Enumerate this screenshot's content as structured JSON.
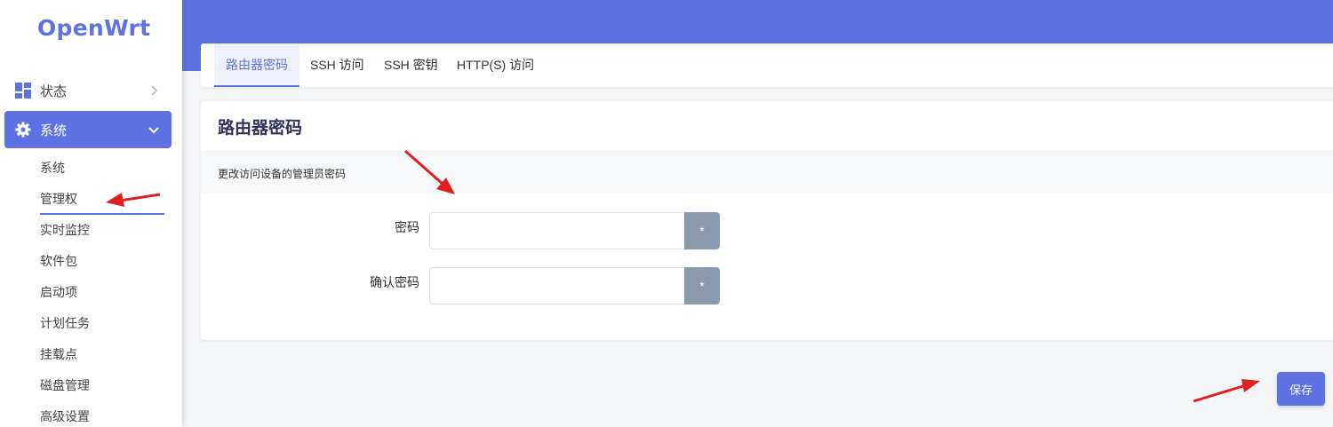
{
  "brand": {
    "logo": "OpenWrt"
  },
  "sidebar": {
    "status": {
      "label": "状态",
      "icon": "dashboard-icon"
    },
    "system": {
      "label": "系统",
      "icon": "gear-icon"
    },
    "sub_items": [
      "系统",
      "管理权",
      "实时监控",
      "软件包",
      "启动项",
      "计划任务",
      "挂载点",
      "磁盘管理",
      "高级设置"
    ]
  },
  "tabs": [
    {
      "label": "路由器密码",
      "active": true
    },
    {
      "label": "SSH 访问"
    },
    {
      "label": "SSH 密钥"
    },
    {
      "label": "HTTP(S) 访问"
    }
  ],
  "section": {
    "title": "路由器密码",
    "description": "更改访问设备的管理员密码",
    "fields": [
      {
        "label": "密码",
        "value": "",
        "reveal_label": "*"
      },
      {
        "label": "确认密码",
        "value": "",
        "reveal_label": "*"
      }
    ]
  },
  "actions": {
    "save_label": "保存"
  },
  "colors": {
    "accent": "#5e72e4",
    "reveal_button": "#8a9aae",
    "annotation_arrow": "#e02020"
  }
}
